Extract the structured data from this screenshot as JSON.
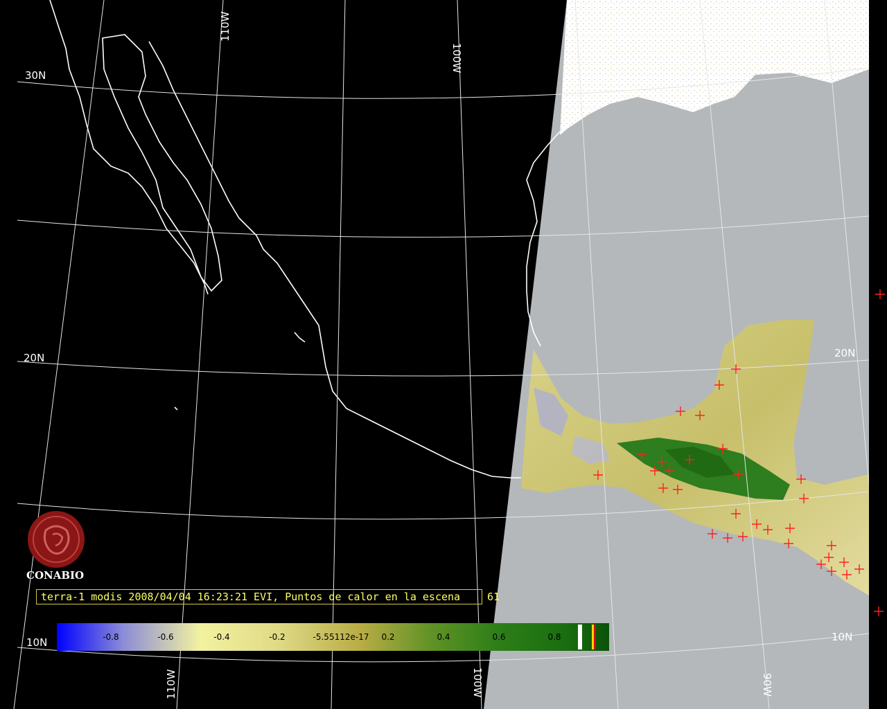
{
  "map": {
    "grid_labels": {
      "lat_30": "30N",
      "lat_20_left": "20N",
      "lat_20_right": "20N",
      "lat_10_left": "10N",
      "lat_10_right": "10N",
      "lon_110_top": "110W",
      "lon_100_top": "100W",
      "lon_110_bottom": "110W",
      "lon_100_bottom": "100W",
      "lon_90_bottom": "90W"
    },
    "colors": {
      "background": "#000000",
      "ocean_day": "#b4b8ba",
      "coast": "#ffffff",
      "fire_marker": "#ff2020",
      "caption_text": "#ffff66",
      "caption_border": "#d8c94a"
    },
    "hotspot_marker": "red-cross-icon"
  },
  "caption": {
    "text": "terra-1 modis 2008/04/04 16:23:21 EVI, Puntos de calor en la escena",
    "count_fragment": "61"
  },
  "logo": {
    "name": "CONABIO"
  },
  "colorbar": {
    "ticks": [
      "-0.8",
      "-0.6",
      "-0.4",
      "-0.2",
      "-5.55112e-17",
      "0.2",
      "0.4",
      "0.6",
      "0.8"
    ],
    "gradient_stops": [
      "#0000ff",
      "#8c8cd8",
      "#f2f2a0",
      "#d7d27a",
      "#b8ac45",
      "#7c9b30",
      "#3b8a1c",
      "#1a6e10",
      "#0a5208"
    ]
  }
}
